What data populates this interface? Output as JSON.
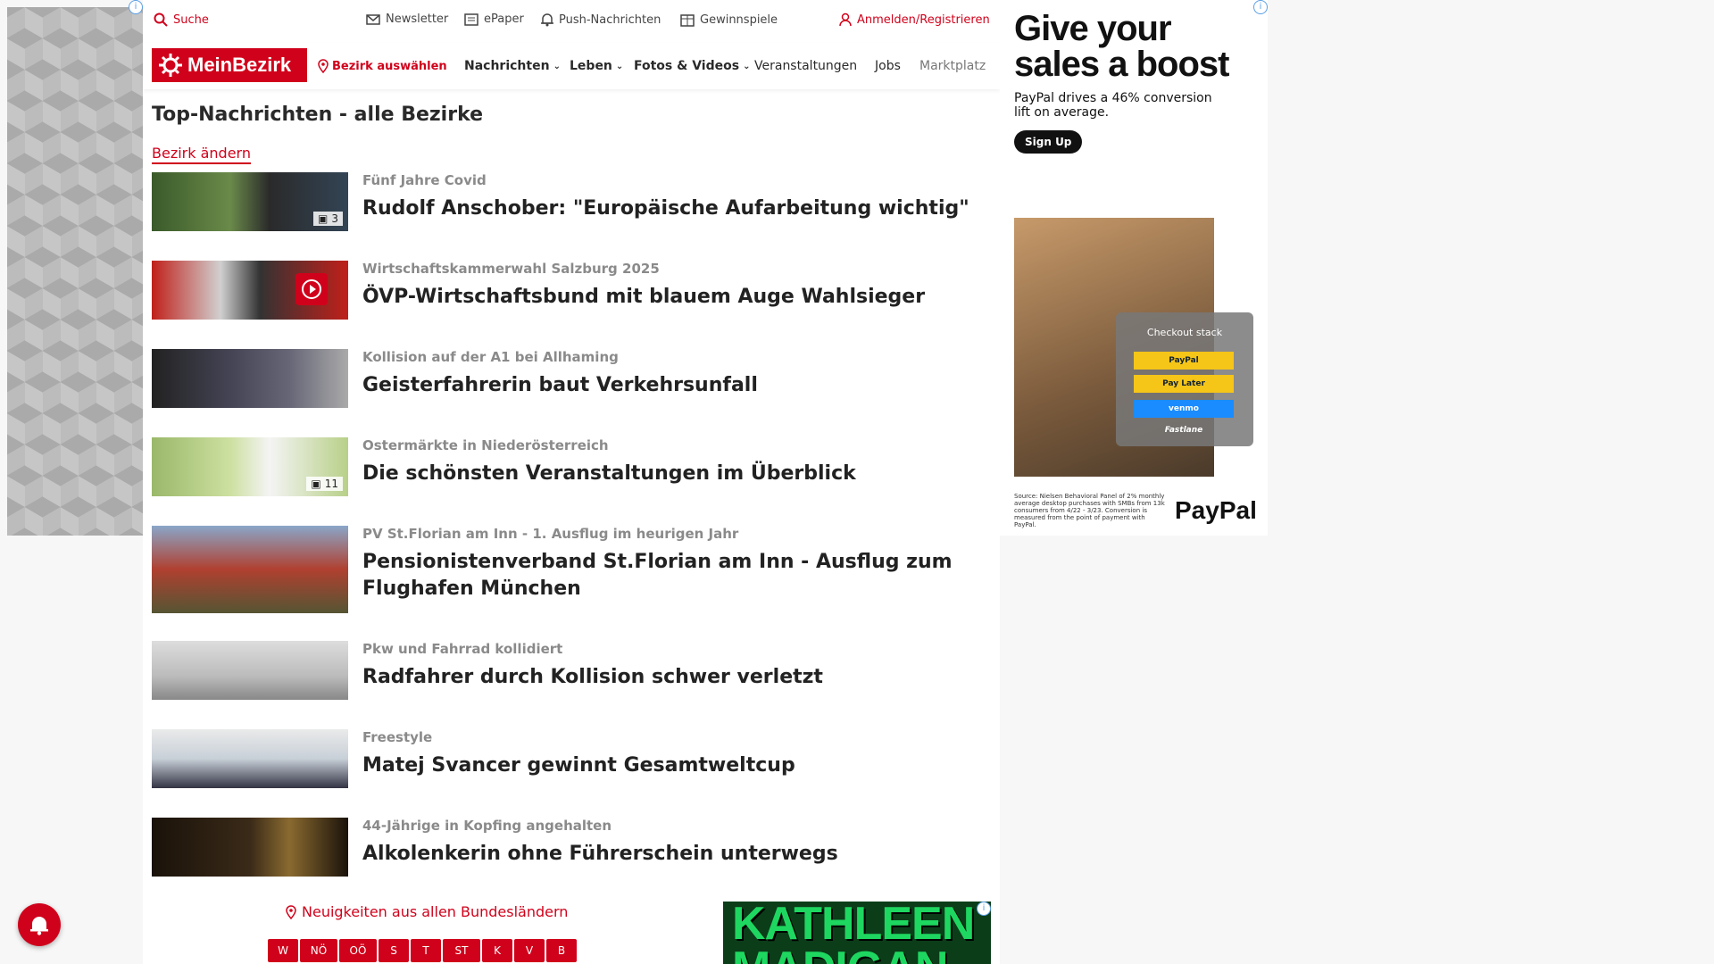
{
  "topbar": {
    "search_label": "Suche",
    "newsletter_label": "Newsletter",
    "epaper_label": "ePaper",
    "push_label": "Push-Nachrichten",
    "gewinnspiele_label": "Gewinnspiele",
    "login_label": "Anmelden/Registrieren"
  },
  "nav": {
    "logo_text": "MeinBezirk",
    "bezirk_label": "Bezirk auswählen",
    "items": [
      {
        "label": "Nachrichten"
      },
      {
        "label": "Leben"
      },
      {
        "label": "Fotos & Videos"
      },
      {
        "label": "Veranstaltungen"
      },
      {
        "label": "Jobs"
      },
      {
        "label": "Marktplatz"
      }
    ]
  },
  "section": {
    "title": "Top-Nachrichten - alle Bezirke",
    "change_label": "Bezirk ändern"
  },
  "articles": [
    {
      "kicker": "Fünf Jahre Covid",
      "headline": "Rudolf Anschober: \"Europäische Aufarbeitung wichtig\"",
      "badge": "3"
    },
    {
      "kicker": "Wirtschaftskammerwahl Salzburg 2025",
      "headline": "ÖVP-Wirtschaftsbund mit blauem Auge Wahlsieger"
    },
    {
      "kicker": "Kollision auf der A1 bei Allhaming",
      "headline": "Geisterfahrerin baut Verkehrsunfall"
    },
    {
      "kicker": "Ostermärkte in Niederösterreich",
      "headline": "Die schönsten Veranstaltungen im Überblick",
      "badge": "11"
    },
    {
      "kicker": "PV St.Florian am Inn - 1. Ausflug im heurigen Jahr",
      "headline": "Pensionistenverband St.Florian am Inn - Ausflug zum Flughafen München"
    },
    {
      "kicker": "Pkw und Fahrrad kollidiert",
      "headline": "Radfahrer durch Kollision schwer verletzt"
    },
    {
      "kicker": "Freestyle",
      "headline": "Matej Svancer gewinnt Gesamtweltcup"
    },
    {
      "kicker": "44-Jährige in Kopfing angehalten",
      "headline": "Alkolenkerin ohne Führerschein unterwegs"
    }
  ],
  "bundeslaender": {
    "link_label": "Neuigkeiten aus allen Bundesländern",
    "states": [
      "W",
      "NÖ",
      "OÖ",
      "S",
      "T",
      "ST",
      "K",
      "V",
      "B"
    ]
  },
  "ad_right": {
    "headline_1": "Give your",
    "headline_2": "sales a boost",
    "subtext": "PayPal drives a 46% conversion lift on average.",
    "button": "Sign Up",
    "checkout_title": "Checkout stack",
    "opt_paypal": "PayPal",
    "opt_paylater": "Pay Later",
    "opt_venmo": "venmo",
    "opt_fastlane": "Fastlane",
    "fineprint": "Source: Nielsen Behavioral Panel of 2% monthly average desktop purchases with SMBs from 13k consumers from 4/22 - 3/23. Conversion is measured from the point of payment with PayPal.",
    "brand": "PayPal"
  },
  "ad_bottom": {
    "text_1": "KATHLEEN",
    "text_2": "MADIGAN"
  },
  "colors": {
    "brand_red": "#d0021b",
    "text_dark": "#222222",
    "kicker_grey": "#8a8a8a"
  }
}
